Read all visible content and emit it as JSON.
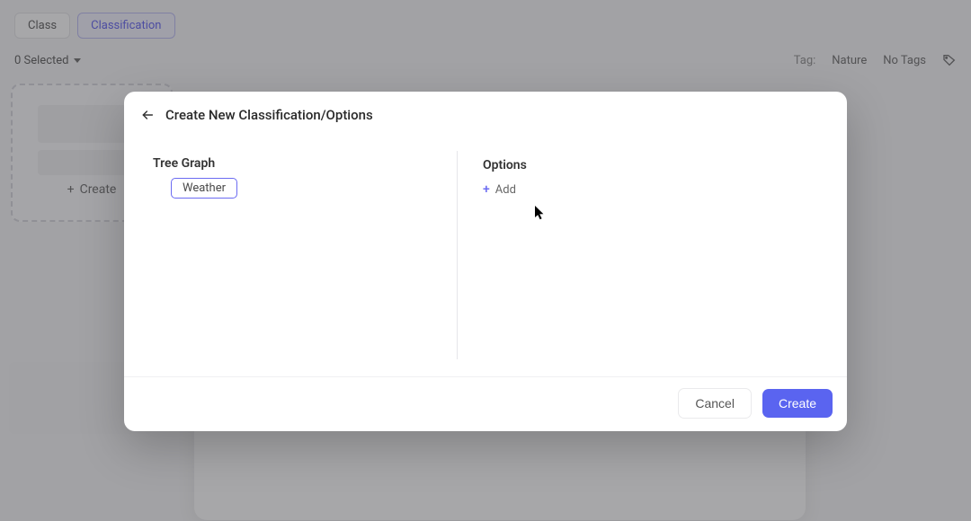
{
  "background": {
    "tabs": {
      "class": "Class",
      "classification": "Classification"
    },
    "selected_text": "0 Selected",
    "tag_label": "Tag:",
    "tag_value": "Nature",
    "tag_none": "No Tags",
    "create_card_text": "Create"
  },
  "modal": {
    "title": "Create New Classification/Options",
    "left_heading": "Tree Graph",
    "tree_node": "Weather",
    "right_heading": "Options",
    "add_label": "Add",
    "cancel": "Cancel",
    "create": "Create"
  }
}
